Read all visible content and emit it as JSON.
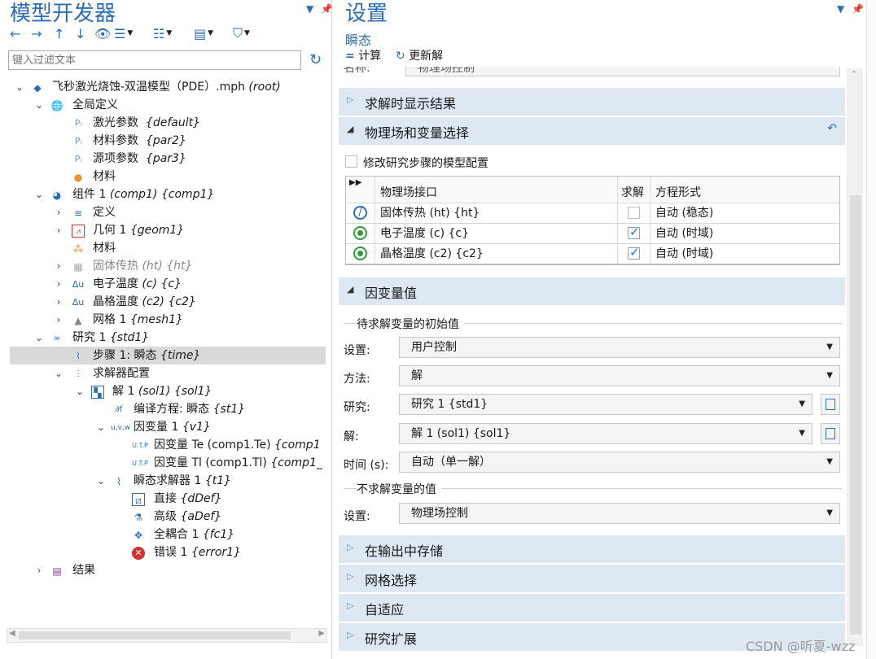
{
  "left": {
    "title": "模型开发器",
    "filter_placeholder": "键入过滤文本",
    "tree": {
      "root": {
        "name": "飞秒激光烧蚀-双温模型（PDE）.mph",
        "tag": "(root)"
      },
      "global": {
        "name": "全局定义"
      },
      "p1": {
        "name": "激光参数",
        "tag": "{default}"
      },
      "p2": {
        "name": "材料参数",
        "tag": "{par2}"
      },
      "p3": {
        "name": "源项参数",
        "tag": "{par3}"
      },
      "mat_g": {
        "name": "材料"
      },
      "comp": {
        "name": "组件 1",
        "tag": "(comp1) {comp1}"
      },
      "def": {
        "name": "定义"
      },
      "geom": {
        "name": "几何 1",
        "tag": "{geom1}"
      },
      "mat_c": {
        "name": "材料"
      },
      "ht": {
        "name": "固体传热",
        "tag": "(ht) {ht}"
      },
      "c": {
        "name": "电子温度",
        "tag": "(c) {c}"
      },
      "c2": {
        "name": "晶格温度",
        "tag": "(c2) {c2}"
      },
      "mesh": {
        "name": "网格 1",
        "tag": "{mesh1}"
      },
      "study": {
        "name": "研究 1",
        "tag": "{std1}"
      },
      "step": {
        "name": "步骤 1: 瞬态",
        "tag": "{time}"
      },
      "solver": {
        "name": "求解器配置"
      },
      "sol": {
        "name": "解 1",
        "tag": "(sol1) {sol1}"
      },
      "compile": {
        "name": "编译方程: 瞬态",
        "tag": "{st1}"
      },
      "dvars": {
        "name": "因变量 1",
        "tag": "{v1}"
      },
      "te": {
        "name": "因变量 Te (comp1.Te)",
        "tag": "{comp1"
      },
      "tl": {
        "name": "因变量 Tl (comp1.Tl)",
        "tag": "{comp1_"
      },
      "tsolver": {
        "name": "瞬态求解器 1",
        "tag": "{t1}"
      },
      "direct": {
        "name": "直接",
        "tag": "{dDef}"
      },
      "adv": {
        "name": "高级",
        "tag": "{aDef}"
      },
      "fc": {
        "name": "全耦合 1",
        "tag": "{fc1}"
      },
      "err": {
        "name": "错误 1",
        "tag": "{error1}"
      },
      "results": {
        "name": "结果"
      }
    }
  },
  "right": {
    "title": "设置",
    "subtitle": "瞬态",
    "compute_label": "计算",
    "update_label": "更新解",
    "cut_label": "名称:",
    "cut_value": "物理场控制",
    "sections": {
      "show_results": "求解时显示结果",
      "physics": "物理场和变量选择",
      "depvals": "因变量值",
      "store": "在输出中存储",
      "mesh_sel": "网格选择",
      "adaptive": "自适应",
      "ext": "研究扩展"
    },
    "modify_config": "修改研究步骤的模型配置",
    "table": {
      "headers": [
        "",
        "物理场接口",
        "求解",
        "方程形式"
      ],
      "rows": [
        {
          "iface": "固体传热 (ht) {ht}",
          "solve": false,
          "form": "自动 (稳态)",
          "icon": "disabled-icon"
        },
        {
          "iface": "电子温度 (c) {c}",
          "solve": true,
          "form": "自动 (时域)",
          "icon": "enabled-icon"
        },
        {
          "iface": "晶格温度 (c2) {c2}",
          "solve": true,
          "form": "自动 (时域)",
          "icon": "enabled-icon"
        }
      ]
    },
    "init_group": "待求解变量的初始值",
    "fields": {
      "setting_label": "设置:",
      "setting_value": "用户控制",
      "method_label": "方法:",
      "method_value": "解",
      "study_label": "研究:",
      "study_value": "研究 1 {std1}",
      "sol_label": "解:",
      "sol_value": "解 1 (sol1) {sol1}",
      "time_label": "时间 (s):",
      "time_value": "自动（单一解）"
    },
    "unsolved_group": "不求解变量的值",
    "unsolved_setting_label": "设置:",
    "unsolved_setting_value": "物理场控制"
  },
  "watermark": "CSDN @听夏-wzz"
}
